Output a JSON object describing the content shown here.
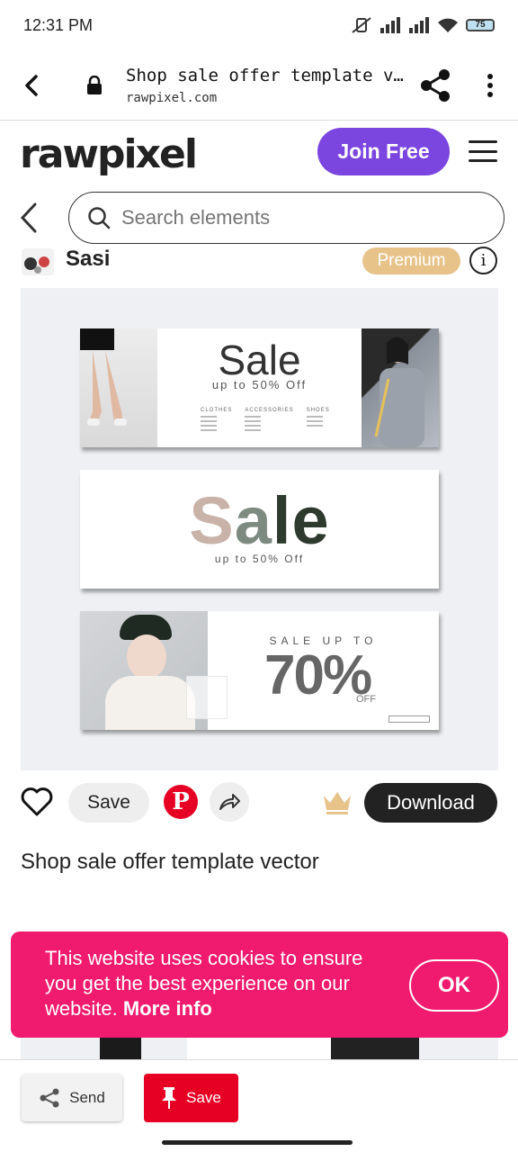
{
  "status_bar": {
    "time": "12:31 PM",
    "battery": "75"
  },
  "browser": {
    "page_title": "Shop sale offer template vec...",
    "domain": "rawpixel.com"
  },
  "site": {
    "logo": "rawpixel",
    "join_label": "Join Free",
    "brand_color": "#7b45e0"
  },
  "search": {
    "placeholder": "Search elements"
  },
  "author": {
    "name": "Sasi",
    "badge": "Premium"
  },
  "preview": {
    "banner1": {
      "headline": "Sale",
      "sub": "up to 50% Off",
      "categories": [
        "CLOTHES",
        "ACCESSORIES",
        "SHOES"
      ]
    },
    "banner2": {
      "headline_a": "S",
      "headline_b": "a",
      "headline_c": "le",
      "sub": "up to 50% Off"
    },
    "banner3": {
      "top": "SALE UP TO",
      "percent": "70%",
      "off": "OFF"
    }
  },
  "actions": {
    "save_label": "Save",
    "pinterest_glyph": "P",
    "download_label": "Download"
  },
  "item_title": "Shop sale offer template vector",
  "cookie": {
    "text": "This website uses cookies to ensure you get the best experience on our website.",
    "more_info": "More info",
    "ok_label": "OK",
    "bg_color": "#f01a6e"
  },
  "bottom_bar": {
    "send_label": "Send",
    "save_label": "Save"
  }
}
